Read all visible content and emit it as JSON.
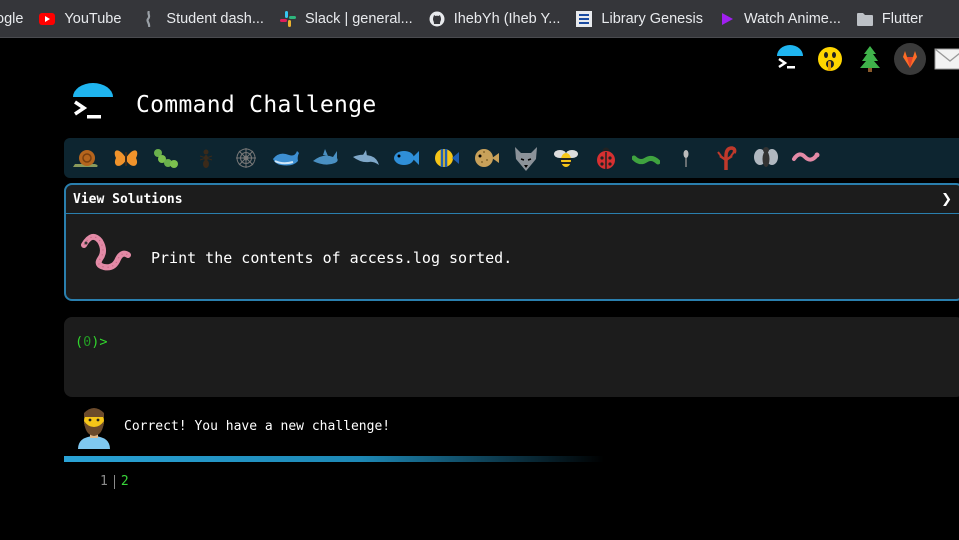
{
  "bookmarks": [
    {
      "label": "ogle",
      "icon": "google-icon"
    },
    {
      "label": "YouTube",
      "icon": "youtube-icon"
    },
    {
      "label": "Student dash...",
      "icon": "student-dash-icon"
    },
    {
      "label": "Slack | general...",
      "icon": "slack-icon"
    },
    {
      "label": "IhebYh (Iheb Y...",
      "icon": "github-icon"
    },
    {
      "label": "Library Genesis",
      "icon": "library-genesis-icon"
    },
    {
      "label": "Watch Anime...",
      "icon": "play-icon"
    },
    {
      "label": "Flutter",
      "icon": "folder-icon"
    }
  ],
  "header": {
    "title": "Command Challenge"
  },
  "challenge": {
    "view_solutions": "View Solutions",
    "chevron": "❯",
    "task": "Print the contents of access.log sorted."
  },
  "terminal": {
    "prompt_open": "(",
    "prompt_num": "0",
    "prompt_close": ")>"
  },
  "response": {
    "message": "Correct! You have a new challenge!"
  },
  "output": {
    "line_number": "1",
    "value": "2"
  },
  "colors": {
    "accent": "#2a7fae",
    "prompt": "#31d62d",
    "panel": "#1c1c1c",
    "strip": "#0d2530"
  }
}
